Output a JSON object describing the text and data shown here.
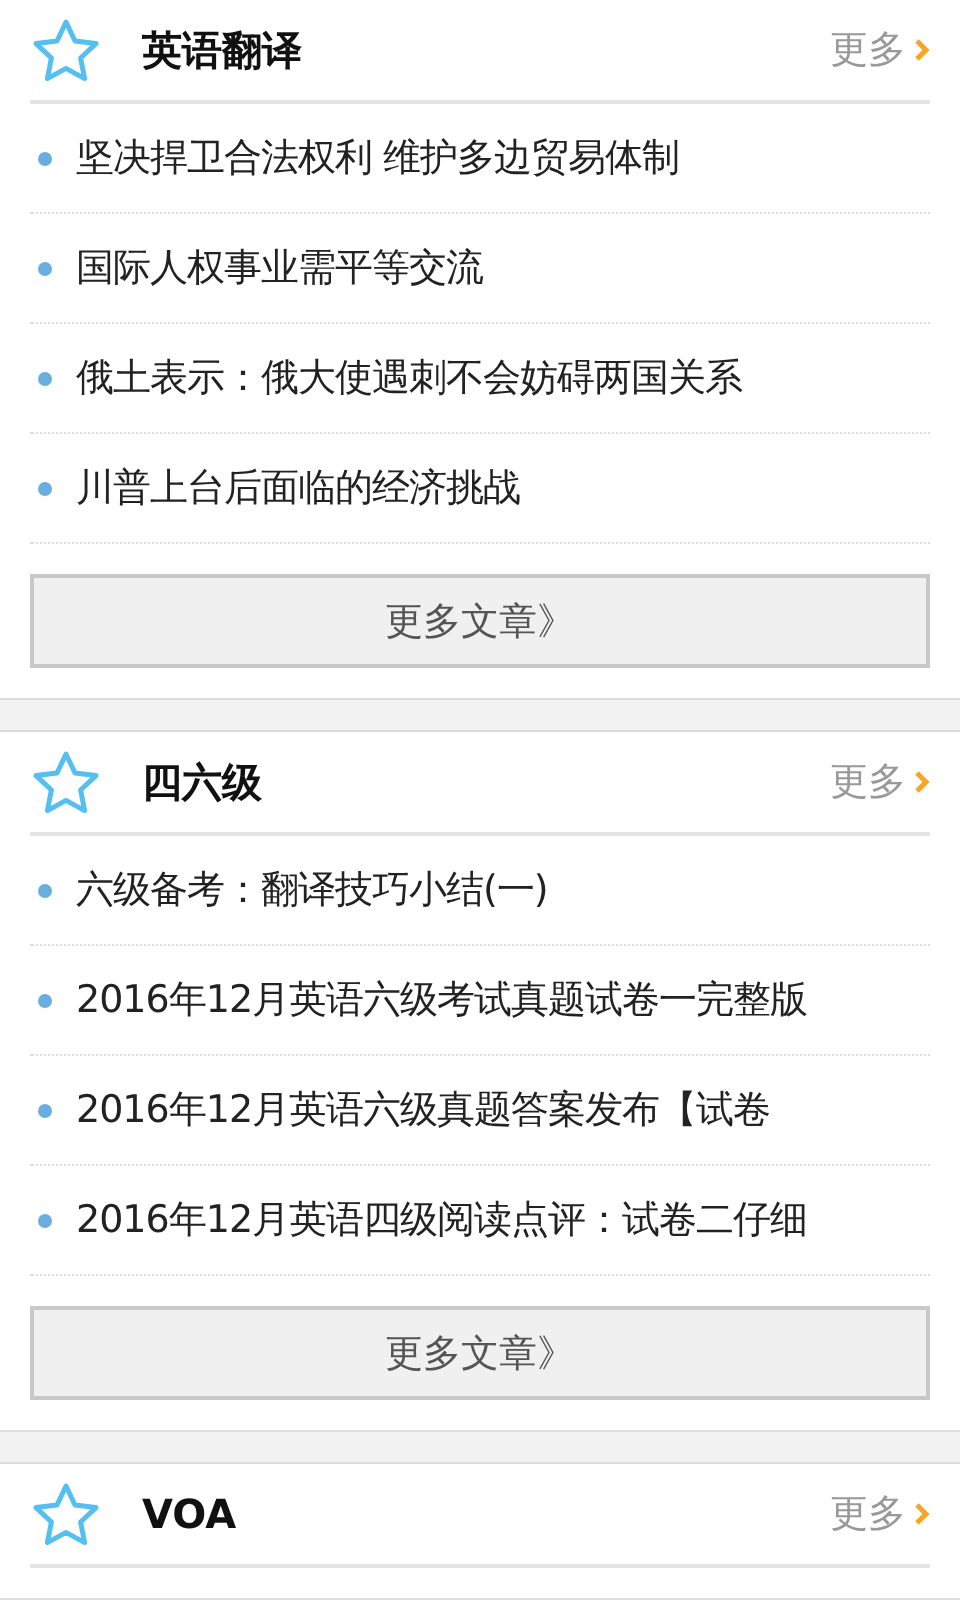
{
  "sections": [
    {
      "title": "英语翻译",
      "more": "更多",
      "items": [
        "坚决捍卫合法权利 维护多边贸易体制",
        "国际人权事业需平等交流",
        "俄土表示：俄大使遇刺不会妨碍两国关系",
        "川普上台后面临的经济挑战"
      ],
      "button": "更多文章》"
    },
    {
      "title": "四六级",
      "more": "更多",
      "items": [
        "六级备考：翻译技巧小结(一)",
        "2016年12月英语六级考试真题试卷一完整版",
        "2016年12月英语六级真题答案发布【试卷",
        "2016年12月英语四级阅读点评：试卷二仔细"
      ],
      "button": "更多文章》"
    },
    {
      "title": "VOA",
      "more": "更多"
    }
  ]
}
